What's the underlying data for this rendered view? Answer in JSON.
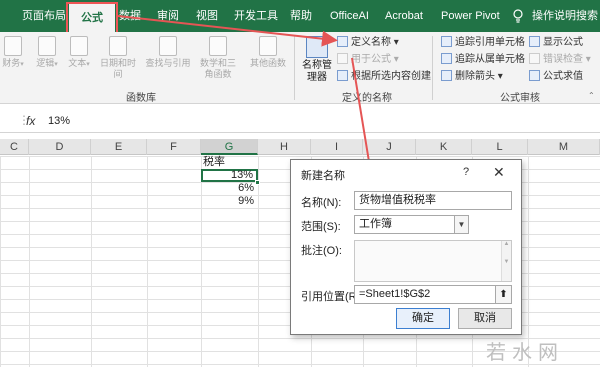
{
  "tabs": [
    {
      "label": "页面布局"
    },
    {
      "label": "公式"
    },
    {
      "label": "数据"
    },
    {
      "label": "审阅"
    },
    {
      "label": "视图"
    },
    {
      "label": "开发工具"
    },
    {
      "label": "帮助"
    },
    {
      "label": "OfficeAI"
    },
    {
      "label": "Acrobat"
    },
    {
      "label": "Power Pivot"
    },
    {
      "label": "操作说明搜索"
    }
  ],
  "ribbon": {
    "function_library": {
      "label": "函数库",
      "buttons": [
        {
          "label": "财务"
        },
        {
          "label": "逻辑"
        },
        {
          "label": "文本"
        },
        {
          "label": "日期和时间"
        },
        {
          "label": "查找与引用"
        },
        {
          "label": "数学和三角函数"
        },
        {
          "label": "其他函数"
        }
      ]
    },
    "defined_names": {
      "label": "定义的名称",
      "name_manager": "名称管理器",
      "define_name": "定义名称",
      "use_in_formula": "用于公式",
      "create_from_selection": "根据所选内容创建"
    },
    "formula_auditing": {
      "label": "公式审核",
      "trace_precedents": "追踪引用单元格",
      "trace_dependents": "追踪从属单元格",
      "remove_arrows": "删除箭头",
      "show_formulas": "显示公式",
      "error_checking": "错误检查",
      "evaluate_formula": "公式求值"
    }
  },
  "formula_bar": {
    "fx": "fx",
    "value": "13%"
  },
  "columns": [
    "C",
    "D",
    "E",
    "F",
    "G",
    "H",
    "I",
    "J",
    "K",
    "L",
    "M"
  ],
  "sheet": {
    "header": "税率",
    "values": [
      "13%",
      "6%",
      "9%"
    ]
  },
  "dialog": {
    "title": "新建名称",
    "help": "?",
    "close": "✕",
    "name_label": "名称(N):",
    "name_value": "货物增值税税率",
    "scope_label": "范围(S):",
    "scope_value": "工作簿",
    "comment_label": "批注(O):",
    "ref_label": "引用位置(R):",
    "ref_value": "=Sheet1!$G$2",
    "ok": "确定",
    "cancel": "取消"
  },
  "watermark": "若水网",
  "colors": {
    "ribbon_green": "#217346",
    "highlight_red": "#e55555"
  }
}
